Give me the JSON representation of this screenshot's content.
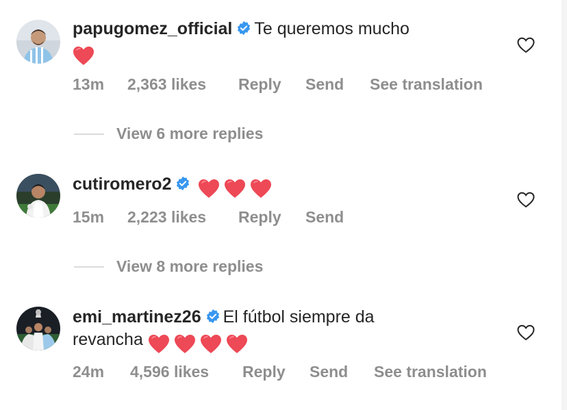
{
  "colors": {
    "text": "#262626",
    "muted": "#8e8e8e",
    "verified": "#3897f0",
    "heart": "#ed4956"
  },
  "comments": [
    {
      "username": "papugomez_official",
      "verified": true,
      "text_line1": "Te queremos mucho",
      "text_line2": "",
      "hearts": 1,
      "time": "13m",
      "likes": "2,363 likes",
      "reply": "Reply",
      "send": "Send",
      "see_translation": "See translation",
      "more_replies": "View 6 more replies"
    },
    {
      "username": "cutiromero2",
      "verified": true,
      "text_line1": "",
      "text_line2": "",
      "hearts": 3,
      "time": "15m",
      "likes": "2,223 likes",
      "reply": "Reply",
      "send": "Send",
      "see_translation": "",
      "more_replies": "View 8 more replies"
    },
    {
      "username": "emi_martinez26",
      "verified": true,
      "text_line1": "El fútbol siempre da",
      "text_line2": "revancha",
      "hearts": 4,
      "time": "24m",
      "likes": "4,596 likes",
      "reply": "Reply",
      "send": "Send",
      "see_translation": "See translation",
      "more_replies": ""
    }
  ]
}
